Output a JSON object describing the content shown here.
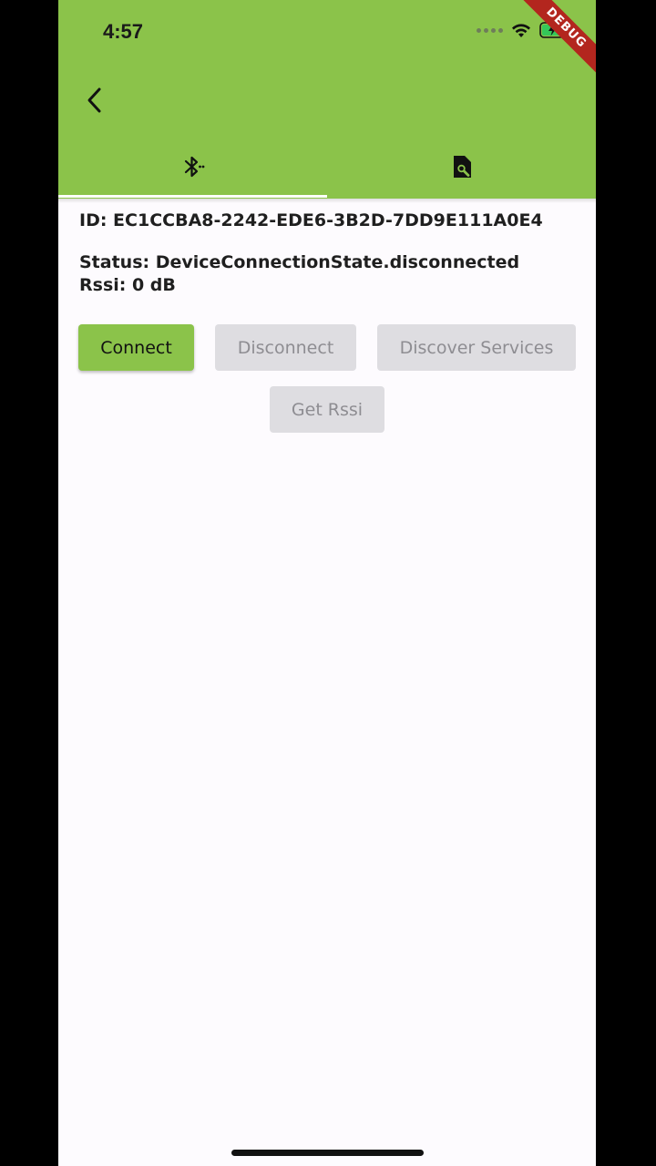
{
  "colors": {
    "app_bar": "#8BC34A",
    "accent_button": "#8BC34A",
    "tab_indicator": "#FFFFFF",
    "disabled_button": "#DEDDE1",
    "background": "#FDFBFE",
    "debug_banner": "#B3261E"
  },
  "status_bar": {
    "time": "4:57",
    "icons": [
      "signal-dots-icon",
      "wifi-icon",
      "battery-charging-icon"
    ]
  },
  "debug_banner": "DEBUG",
  "app_bar": {
    "back_icon": "chevron-left-icon",
    "tabs": [
      {
        "icon": "bluetooth-searching-icon",
        "selected": true
      },
      {
        "icon": "find-in-page-icon",
        "selected": false
      }
    ]
  },
  "device": {
    "id_line": "ID: EC1CCBA8-2242-EDE6-3B2D-7DD9E111A0E4",
    "status_line": "Status: DeviceConnectionState.disconnected",
    "rssi_line": "Rssi: 0 dB"
  },
  "buttons": {
    "connect": "Connect",
    "disconnect": "Disconnect",
    "discover_services": "Discover Services",
    "get_rssi": "Get Rssi"
  }
}
